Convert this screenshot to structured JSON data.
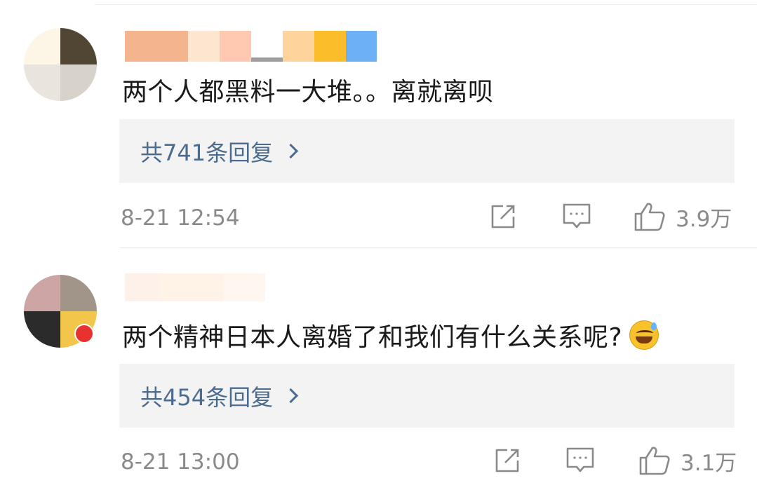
{
  "comments": [
    {
      "text": "两个人都黑料一大堆。。离就离呗",
      "replies_label": "共741条回复",
      "timestamp": "8-21 12:54",
      "likes": "3.9万",
      "avatar_colors": [
        "#fdf5e6",
        "#514533",
        "#e9e5dd",
        "#d7d3cb"
      ],
      "name_colors": [
        "#f4b48e",
        "#fba978",
        "#fde6cf",
        "#fec8b1",
        "#9d9d9d",
        "#fed39c",
        "#fbbd2a",
        "#6eb0f5"
      ]
    },
    {
      "text": "两个精神日本人离婚了和我们有什么关系呢?",
      "emoji": "grinning-sweat-emoji",
      "replies_label": "共454条回复",
      "timestamp": "8-21 13:00",
      "likes": "3.1万",
      "avatar_colors": [
        "#cea5a5",
        "#a1958a",
        "#2b2b2b",
        "#f2c64a"
      ],
      "name_colors": [
        "#fdf1ea",
        "#fff3e8",
        "#fef6ef",
        "#fbe8d8"
      ]
    }
  ],
  "icons": {
    "share": "share-icon",
    "comment": "comment-icon",
    "like": "thumbs-up-icon"
  }
}
